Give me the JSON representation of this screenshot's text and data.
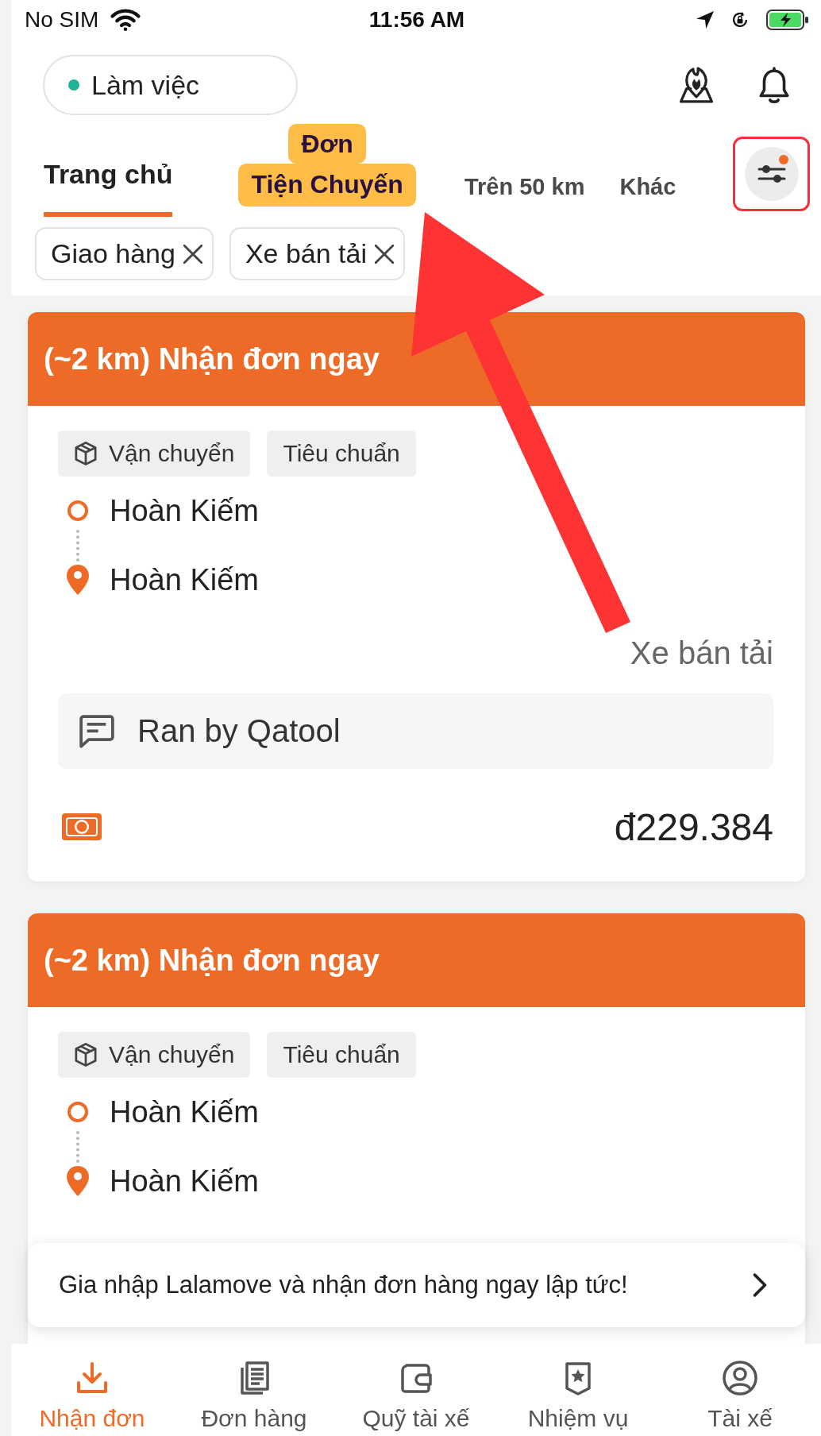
{
  "status_bar": {
    "carrier": "No SIM",
    "time": "11:56 AM"
  },
  "header": {
    "status": {
      "label": "Làm việc",
      "online": true
    }
  },
  "tabs": [
    {
      "label": "Trang chủ",
      "selected": true
    },
    {
      "label": "Trên 50 km",
      "selected": false
    },
    {
      "label": "Khác",
      "selected": false
    }
  ],
  "filter": {
    "active": true,
    "highlighted": true
  },
  "chips": [
    {
      "label": "Giao hàng"
    },
    {
      "label": "Xe bán tải"
    }
  ],
  "orders": [
    {
      "header": "(~2 km) Nhận đơn ngay",
      "tags": [
        {
          "label": "Vận chuyển",
          "kind": "icon"
        },
        {
          "label": "Tiêu chuẩn",
          "kind": "plain"
        }
      ],
      "pickup": "Hoàn Kiếm",
      "dropoff": "Hoàn Kiếm",
      "vehicle": "Xe bán tải",
      "note": "Ran by Qatool",
      "price": "đ229.384"
    },
    {
      "header": "(~2 km) Nhận đơn ngay",
      "tags": [
        {
          "label": "Vận chuyển",
          "kind": "icon"
        },
        {
          "label": "Tiêu chuẩn",
          "kind": "plain"
        }
      ],
      "pickup": "Hoàn Kiếm",
      "dropoff": "Hoàn Kiếm"
    }
  ],
  "banner": {
    "text": "Gia nhập Lalamove và nhận đơn hàng ngay lập tức!"
  },
  "bottom_nav": [
    {
      "label": "Nhận đơn",
      "selected": true
    },
    {
      "label": "Đơn hàng",
      "selected": false
    },
    {
      "label": "Quỹ tài xế",
      "selected": false
    },
    {
      "label": "Nhiệm vụ",
      "selected": false
    },
    {
      "label": "Tài xế",
      "selected": false
    }
  ],
  "annotation": {
    "lines": [
      "Đơn",
      "Tiện Chuyến"
    ]
  }
}
